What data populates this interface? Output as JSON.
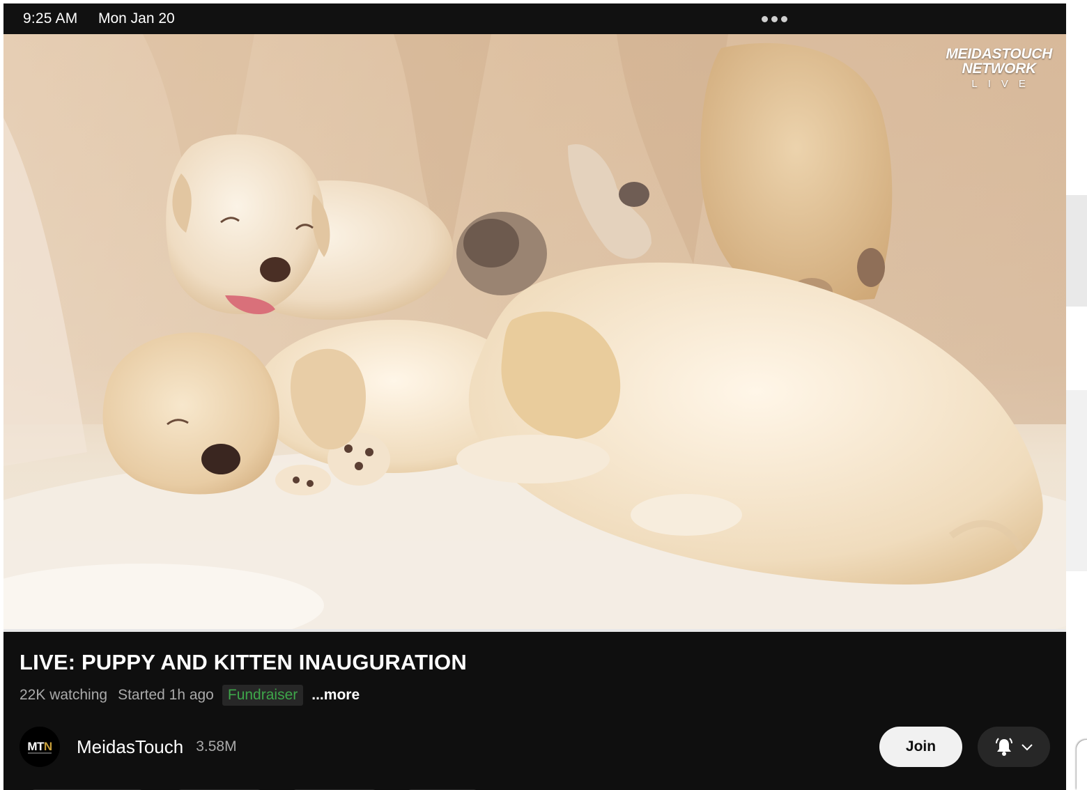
{
  "status_bar": {
    "time": "9:25 AM",
    "date": "Mon Jan 20"
  },
  "video": {
    "watermark_line1": "MEIDASTOUCH",
    "watermark_line2": "NETWORK",
    "watermark_line3": "LIVE",
    "scene_icon": "sleeping-puppies-video-frame"
  },
  "info": {
    "title": "LIVE: PUPPY AND KITTEN INAUGURATION",
    "watching": "22K watching",
    "started": "Started 1h ago",
    "badge": "Fundraiser",
    "more": "...more"
  },
  "channel": {
    "avatar_text_a": "MT",
    "avatar_text_b": "N",
    "name": "MeidasTouch",
    "subscribers": "3.58M",
    "join_label": "Join",
    "bell_icon": "bell-icon",
    "chevron_icon": "chevron-down-icon"
  },
  "colors": {
    "background": "#0f0f0f",
    "badge_text": "#3ea64a",
    "avatar_accent": "#c9a03a"
  }
}
